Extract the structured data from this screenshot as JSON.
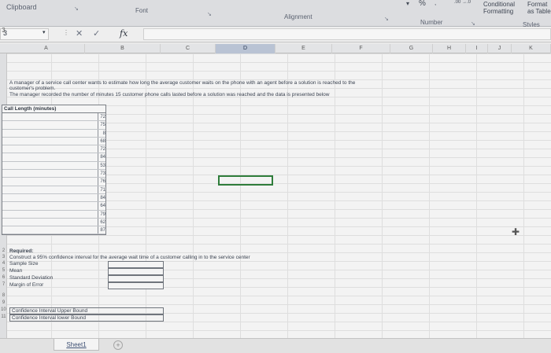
{
  "ribbon": {
    "clipboard": "Clipboard",
    "font": "Font",
    "alignment": "Alignment",
    "number": "Number",
    "percent": "%",
    "comma": ",",
    "decimal_increase": ".00 →.0",
    "conditional_formatting": "Conditional Formatting",
    "format_as_table": "Format as Table",
    "styles": "Styles"
  },
  "formula_bar": {
    "name_box": "3",
    "cancel": "✕",
    "enter": "✓",
    "fx": "fx",
    "value": ""
  },
  "columns": [
    "A",
    "B",
    "C",
    "D",
    "E",
    "F",
    "G",
    "H",
    "I",
    "J",
    "K"
  ],
  "selected_column": "D",
  "sheet": {
    "intro_line1": "A manager of a service call center wants to estimate how long the average customer waits on the phone with an agent before a solution is reached to the",
    "intro_line2": "customer's problem.",
    "intro_line3": "The manager recorded the number of minutes 15 customer phone calls lasted before a solution was reached and the data is presented below",
    "table_header": "Call Length (minutes)",
    "values": [
      "72",
      "75",
      "8",
      "68",
      "72",
      "84",
      "53",
      "73",
      "76",
      "71",
      "84",
      "64",
      "79",
      "62",
      "87"
    ],
    "required_label": "Required:",
    "required_task": "Construct a 95% confidence interval for the average wait time of a customer calling in to the service center",
    "items": [
      "Sample Size",
      "Mean",
      "Standard Deviation",
      "Margin of Error"
    ],
    "bounds": [
      "Confidence Interval Upper Bound",
      "Confidence Interval lower Bound"
    ],
    "row_numbers": [
      "2",
      "3",
      "4",
      "5",
      "6",
      "7",
      "8",
      "9",
      "10",
      "11"
    ],
    "row_numbers_top": "3"
  },
  "tabs": {
    "sheet1": "Sheet1",
    "add": "+"
  }
}
